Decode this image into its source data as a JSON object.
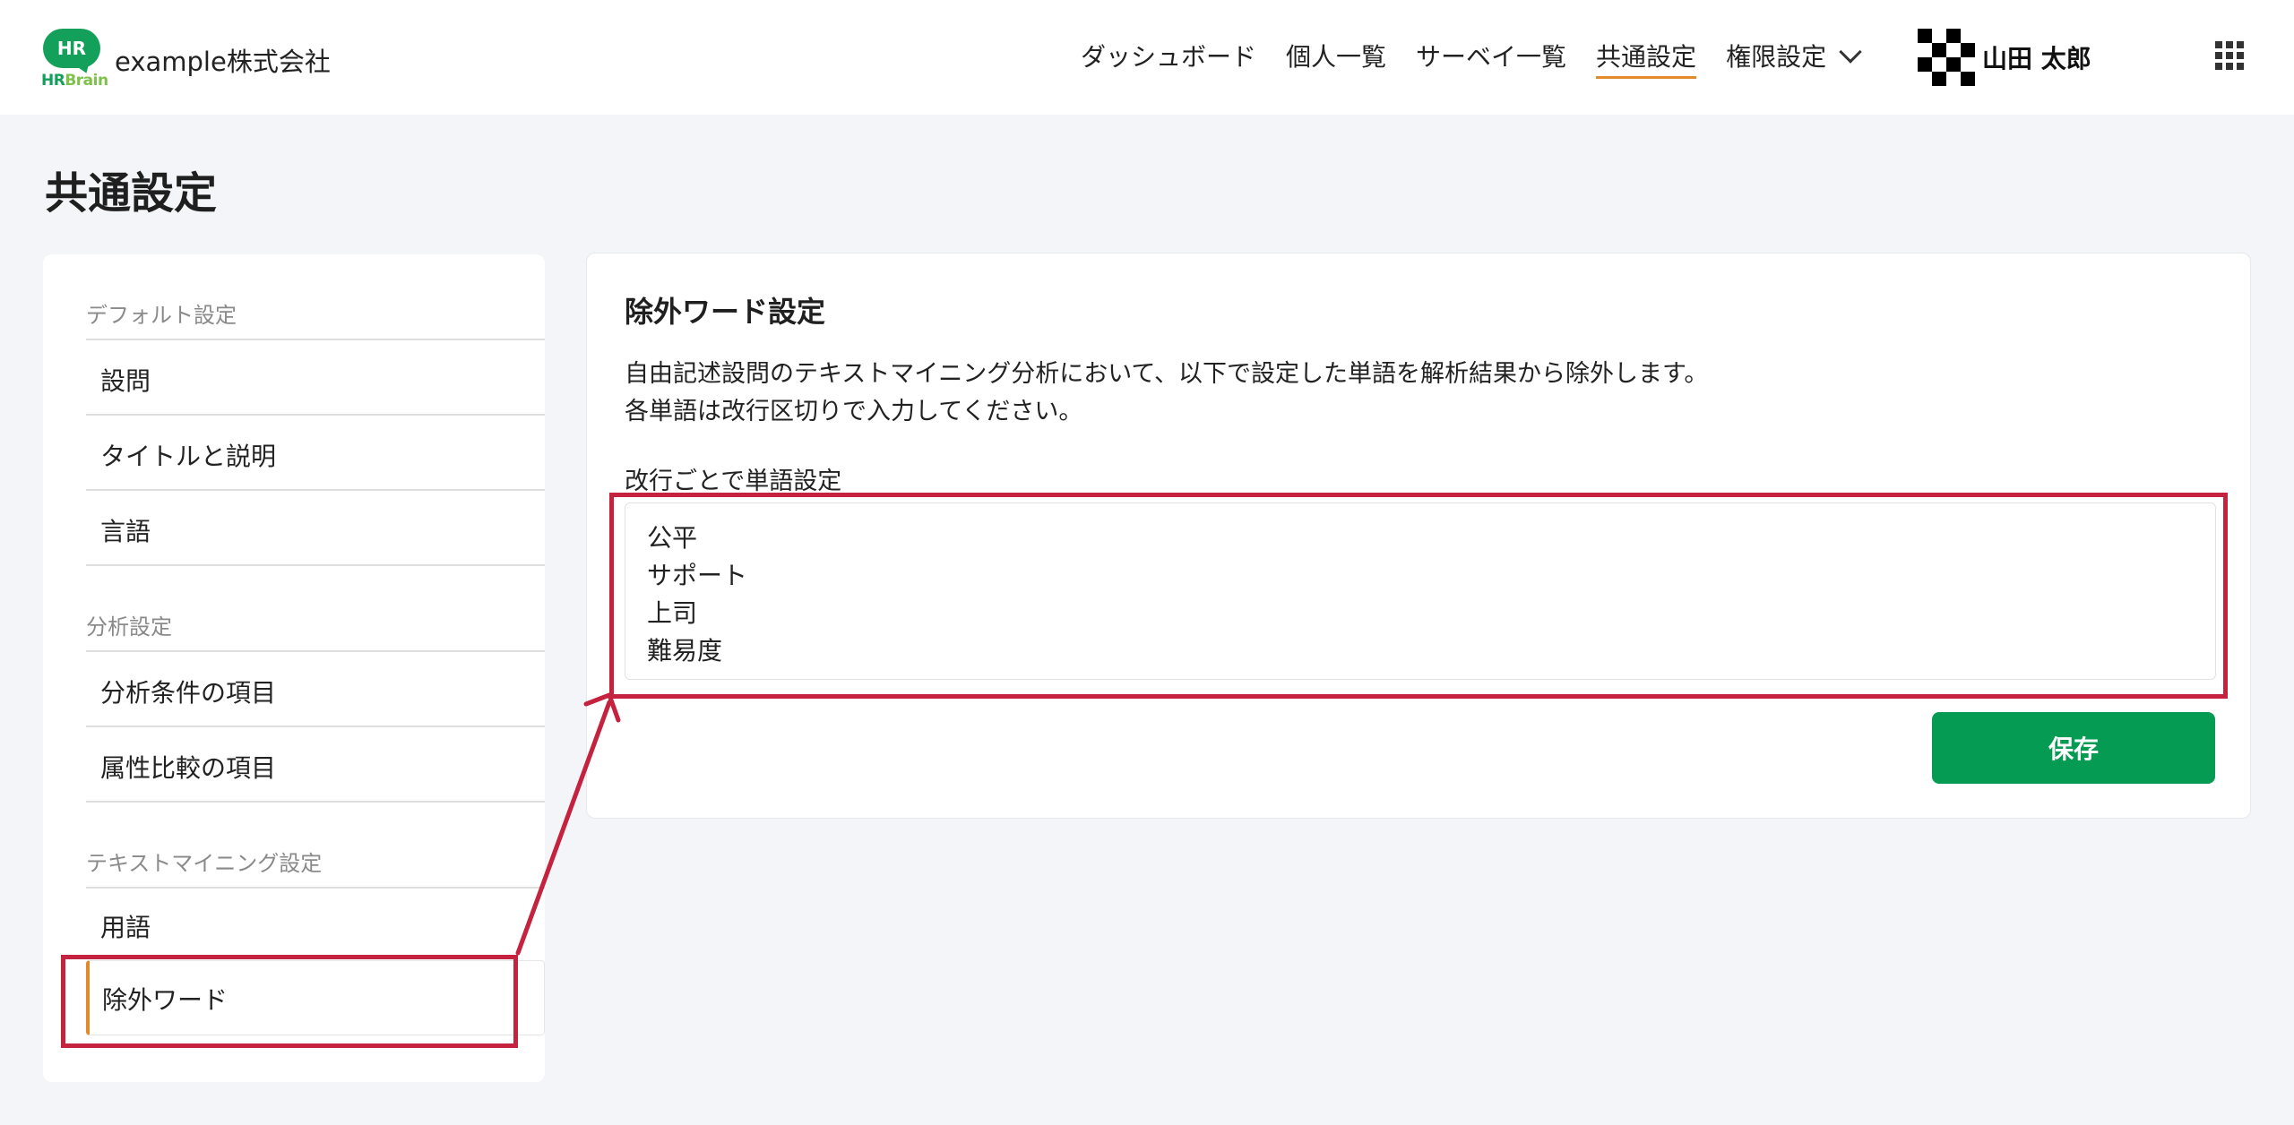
{
  "header": {
    "logo_hr": "HR",
    "logo_text_hr": "HR",
    "logo_text_brain": "Brain",
    "company": "example株式会社",
    "nav": [
      "ダッシュボード",
      "個人一覧",
      "サーベイ一覧",
      "共通設定",
      "権限設定"
    ],
    "active_nav": "共通設定",
    "user_name": "山田 太郎"
  },
  "page": {
    "title": "共通設定"
  },
  "sidebar": {
    "groups": [
      {
        "label": "デフォルト設定",
        "items": [
          "設問",
          "タイトルと説明",
          "言語"
        ]
      },
      {
        "label": "分析設定",
        "items": [
          "分析条件の項目",
          "属性比較の項目"
        ]
      },
      {
        "label": "テキストマイニング設定",
        "items": [
          "用語",
          "除外ワード"
        ]
      }
    ],
    "active_item": "除外ワード"
  },
  "main": {
    "title": "除外ワード設定",
    "description_line1": "自由記述設問のテキストマイニング分析において、以下で設定した単語を解析結果から除外します。",
    "description_line2": "各単語は改行区切りで入力してください。",
    "field_label": "改行ごとで単語設定",
    "words": [
      "公平",
      "サポート",
      "上司",
      "難易度"
    ],
    "save_label": "保存"
  },
  "colors": {
    "brand_green": "#13a05a",
    "save_green": "#059b53",
    "active_accent": "#e08a2c",
    "annotation_red": "#c4223f"
  }
}
